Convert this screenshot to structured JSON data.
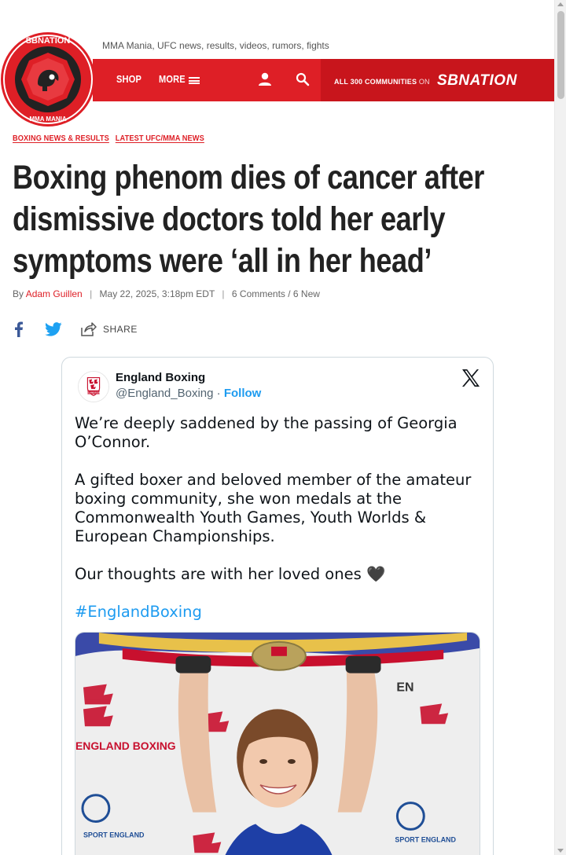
{
  "site": {
    "tagline": "MMA Mania, UFC news, results, videos, rumors, fights",
    "logo_text_top": "SBNATION",
    "logo_text_bottom": "MMA MANIA",
    "nav": {
      "shop": "SHOP",
      "more": "MORE"
    },
    "communities_label": "ALL 300 COMMUNITIES",
    "communities_on": "ON",
    "sbnation_logo": "SBNATION"
  },
  "article": {
    "breadcrumbs": [
      "BOXING NEWS & RESULTS",
      "LATEST UFC/MMA NEWS"
    ],
    "headline": "Boxing phenom dies of cancer after dismissive doctors told her early symptoms were ‘all in her head’",
    "byline_prefix": "By",
    "author": "Adam Guillen",
    "date": "May 22, 2025, 3:18pm EDT",
    "comments": "6 Comments / 6 New",
    "share_label": "SHARE"
  },
  "tweet": {
    "name": "England Boxing",
    "handle": "@England_Boxing",
    "dot": "·",
    "follow": "Follow",
    "para1": "We’re deeply saddened by the passing of Georgia O’Connor.",
    "para2": "A gifted boxer and beloved member of the amateur boxing community, she won medals at the Commonwealth Youth Games, Youth Worlds & European Championships.",
    "para3": "Our thoughts are with her loved ones 🖤",
    "hashtag": "#EnglandBoxing",
    "avatar_text": "ENGLAND BOXING",
    "photo_banner_text": "ENGLAND BOXING",
    "photo_sponsor_text": "SPORT ENGLAND"
  },
  "colors": {
    "brand_red": "#de1f26",
    "link_blue": "#1d9bf0",
    "facebook_blue": "#3b5998",
    "twitter_blue": "#1da1f2"
  },
  "icons": [
    "user-icon",
    "search-icon",
    "hamburger-icon",
    "facebook-icon",
    "twitter-icon",
    "share-icon",
    "x-logo-icon"
  ]
}
